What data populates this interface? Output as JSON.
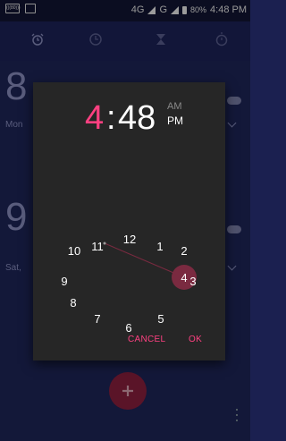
{
  "status_bar": {
    "left_icon_text": "(((80)))",
    "network_4g": "4G",
    "network_g": "G",
    "battery": "80%",
    "time": "4:48 PM"
  },
  "tabs": [
    {
      "icon": "alarm-clock-icon"
    },
    {
      "icon": "clock-icon"
    },
    {
      "icon": "hourglass-icon"
    },
    {
      "icon": "stopwatch-icon"
    }
  ],
  "background": {
    "alarm1_time_fragment": "8",
    "alarm1_days_fragment": "Mon",
    "alarm2_time_fragment": "9",
    "alarm2_days_fragment": "Sat,"
  },
  "dialog": {
    "hour": "4",
    "colon": ":",
    "minute": "48",
    "am": "AM",
    "pm": "PM",
    "selected_hour": "4",
    "clock_numbers": [
      "12",
      "1",
      "2",
      "3",
      "4",
      "5",
      "6",
      "7",
      "8",
      "9",
      "10",
      "11"
    ],
    "cancel": "CANCEL",
    "ok": "OK"
  },
  "colors": {
    "accent": "#ff4081",
    "selected_circle": "#7a2a40",
    "dialog_bg": "#262626",
    "app_bg": "#1e2558"
  }
}
